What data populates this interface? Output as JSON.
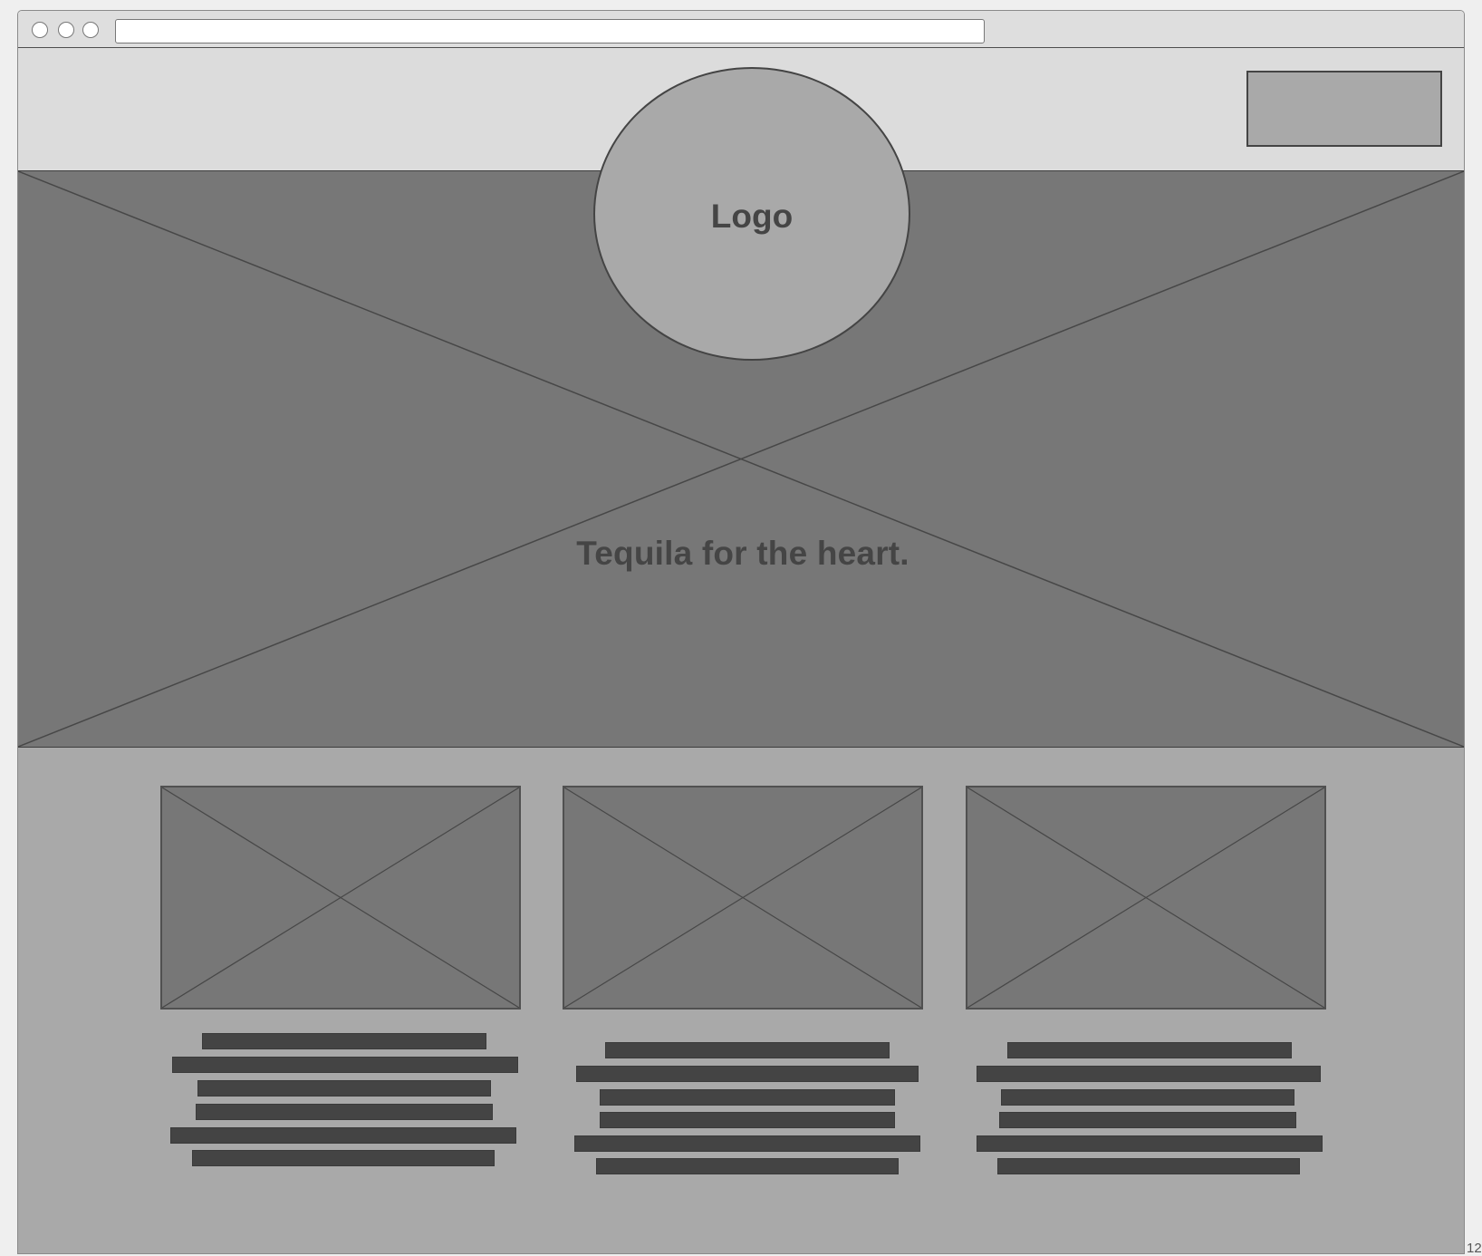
{
  "window": {
    "title_bar": {
      "traffic_lights": [
        "close-light",
        "minimize-light",
        "zoom-light"
      ],
      "address_bar_value": ""
    },
    "header": {
      "logo_label": "Logo",
      "cta_placeholder": "button placeholder"
    },
    "hero": {
      "tagline": "Tequila for the heart."
    },
    "cards": [
      {
        "image": "placeholder-image",
        "text_lines": 6
      },
      {
        "image": "placeholder-image",
        "text_lines": 6
      },
      {
        "image": "placeholder-image",
        "text_lines": 6
      }
    ]
  },
  "page_number_fragment": "12",
  "colors": {
    "chrome_bg": "#dcdcdc",
    "hero_bg": "#777777",
    "content_bg": "#a9a9a9",
    "text_dark": "#454545"
  }
}
